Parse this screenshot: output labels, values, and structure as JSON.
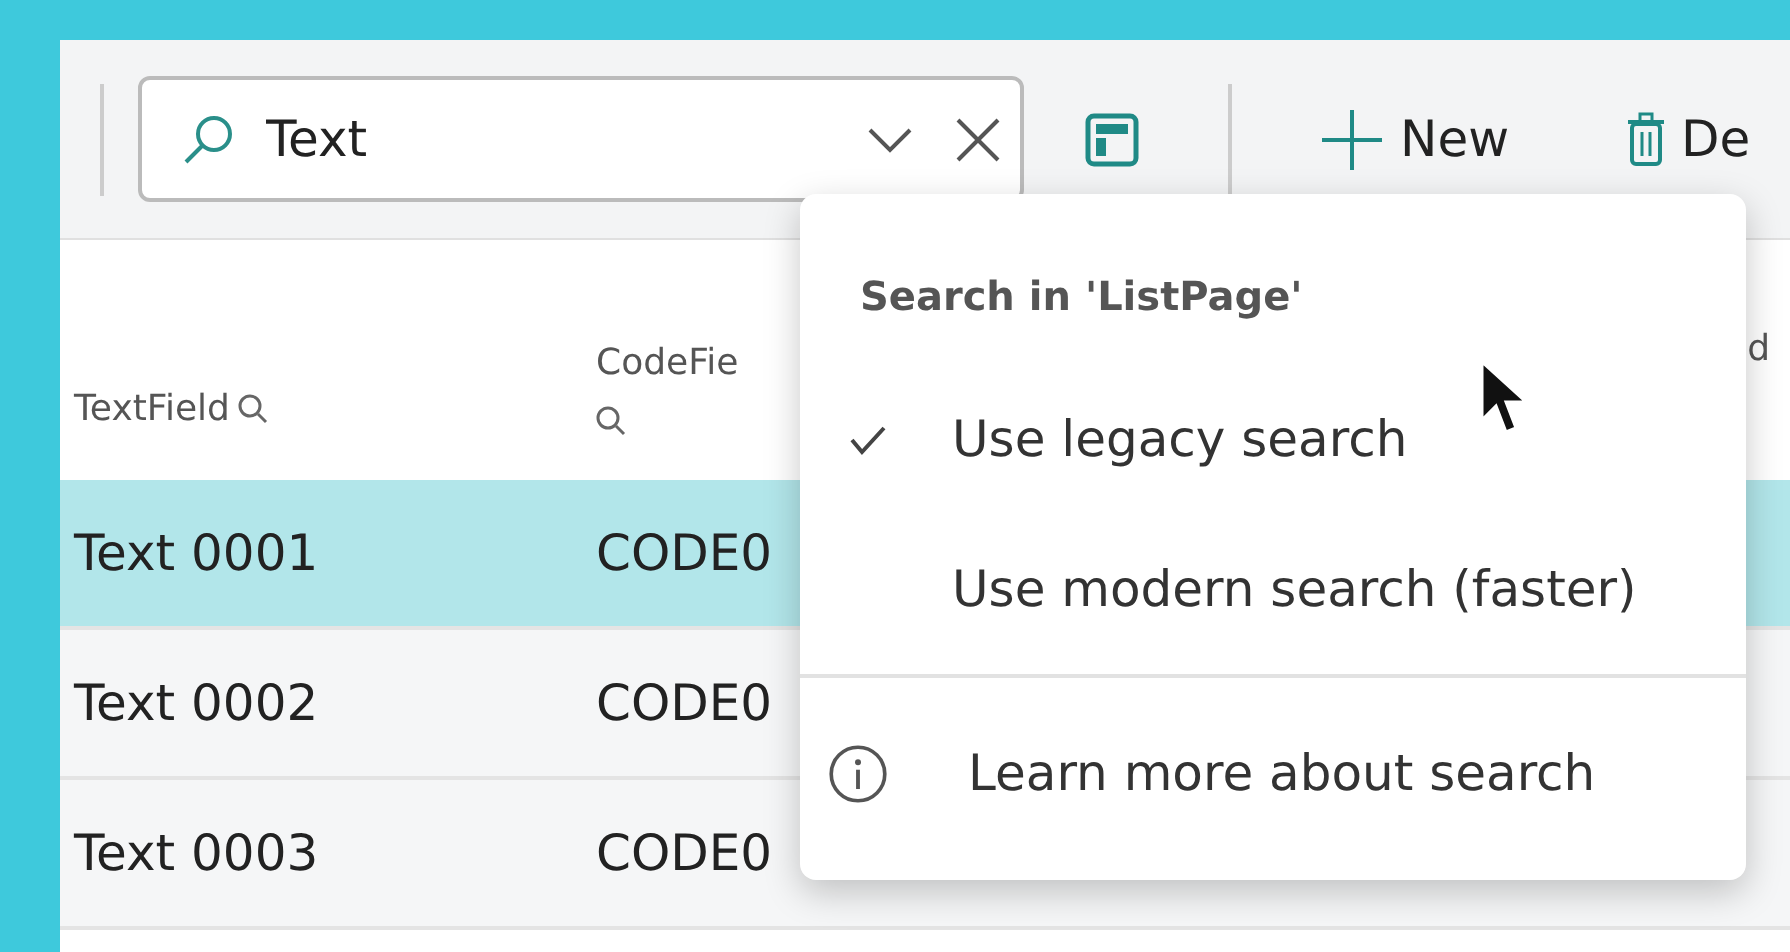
{
  "toolbar": {
    "search": {
      "value": "Text"
    },
    "buttons": [
      {
        "kind": "new",
        "label": "New"
      },
      {
        "kind": "delete",
        "label": "De"
      }
    ]
  },
  "table": {
    "columns": [
      {
        "label": "TextField",
        "searchable": true
      },
      {
        "label": "CodeFie",
        "searchable": true
      },
      {
        "label": "d",
        "searchable": false
      }
    ],
    "rows": [
      {
        "cells": [
          "Text 0001",
          "CODE0"
        ],
        "selected": true
      },
      {
        "cells": [
          "Text 0002",
          "CODE0"
        ],
        "selected": false
      },
      {
        "cells": [
          "Text 0003",
          "CODE0"
        ],
        "selected": false
      }
    ]
  },
  "search_menu": {
    "title": "Search in 'ListPage'",
    "options": [
      {
        "label": "Use legacy search",
        "selected": true
      },
      {
        "label": "Use modern search (faster)",
        "selected": false
      }
    ],
    "link": "Learn more about search"
  }
}
